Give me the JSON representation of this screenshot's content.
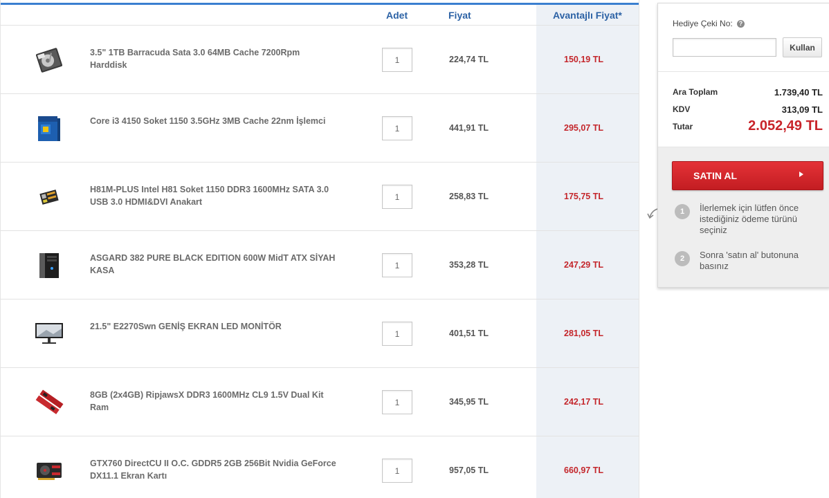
{
  "table": {
    "headers": {
      "qty": "Adet",
      "price": "Fiyat",
      "advantage_price": "Avantajlı Fiyat*"
    },
    "rows": [
      {
        "name": "3.5\" 1TB Barracuda Sata 3.0 64MB Cache 7200Rpm Harddisk",
        "qty": "1",
        "price": "224,74 TL",
        "advantage_price": "150,19 TL",
        "icon": "hard-disk-icon"
      },
      {
        "name": "Core i3 4150 Soket 1150 3.5GHz 3MB Cache 22nm İşlemci",
        "qty": "1",
        "price": "441,91 TL",
        "advantage_price": "295,07 TL",
        "icon": "processor-box-icon"
      },
      {
        "name": "H81M-PLUS Intel H81 Soket 1150 DDR3 1600MHz SATA 3.0 USB 3.0 HDMI&DVI Anakart",
        "qty": "1",
        "price": "258,83 TL",
        "advantage_price": "175,75 TL",
        "icon": "motherboard-icon"
      },
      {
        "name": "ASGARD 382 PURE BLACK EDITION 600W MidT ATX SİYAH KASA",
        "qty": "1",
        "price": "353,28 TL",
        "advantage_price": "247,29 TL",
        "icon": "pc-case-icon"
      },
      {
        "name": "21.5\" E2270Swn GENİŞ EKRAN LED MONİTÖR",
        "qty": "1",
        "price": "401,51 TL",
        "advantage_price": "281,05 TL",
        "icon": "monitor-icon"
      },
      {
        "name": "8GB (2x4GB) RipjawsX DDR3 1600MHz CL9 1.5V Dual Kit Ram",
        "qty": "1",
        "price": "345,95 TL",
        "advantage_price": "242,17 TL",
        "icon": "ram-icon"
      },
      {
        "name": "GTX760 DirectCU II O.C. GDDR5 2GB 256Bit Nvidia GeForce DX11.1 Ekran Kartı",
        "qty": "1",
        "price": "957,05 TL",
        "advantage_price": "660,97 TL",
        "icon": "graphics-card-icon"
      }
    ]
  },
  "panel": {
    "gift_label": "Hediye Çeki No:",
    "gift_value": "",
    "use_button": "Kullan",
    "subtotal_label": "Ara Toplam",
    "subtotal_value": "1.739,40 TL",
    "tax_label": "KDV",
    "tax_value": "313,09 TL",
    "total_label": "Tutar",
    "total_value": "2.052,49 TL",
    "buy_button": "SATIN AL",
    "steps": [
      {
        "num": "1",
        "text": "İlerlemek için lütfen önce istediğiniz ödeme türünü seçiniz"
      },
      {
        "num": "2",
        "text": "Sonra 'satın al' butonuna basınız"
      }
    ]
  },
  "colors": {
    "accent_blue": "#2c62a5",
    "price_red": "#c4262b",
    "buy_red": "#d4272c"
  }
}
